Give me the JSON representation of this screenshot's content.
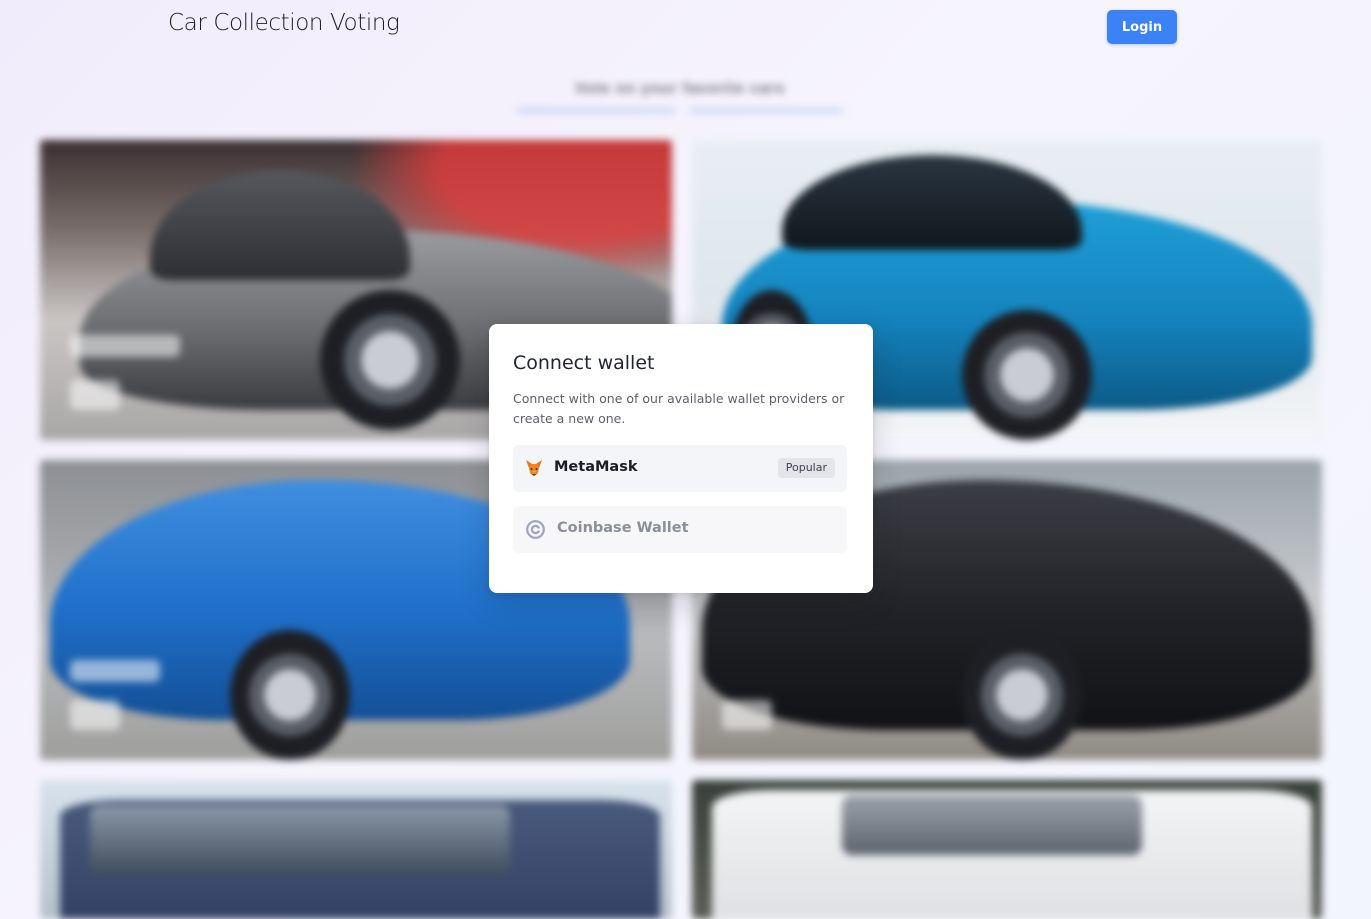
{
  "header": {
    "title": "Car Collection Voting",
    "login_label": "Login"
  },
  "background": {
    "subtitle": "Vote on your favorite cars"
  },
  "modal": {
    "title": "Connect wallet",
    "description": "Connect with one of our available wallet providers or create a new one.",
    "wallets": [
      {
        "name": "MetaMask",
        "badge": "Popular",
        "icon": "metamask-fox-icon",
        "enabled": true
      },
      {
        "name": "Coinbase Wallet",
        "badge": "",
        "icon": "coinbase-icon",
        "enabled": false
      }
    ]
  },
  "colors": {
    "accent": "#3b82f6",
    "modal_bg": "#ffffff",
    "row_bg": "#f4f5f8"
  }
}
